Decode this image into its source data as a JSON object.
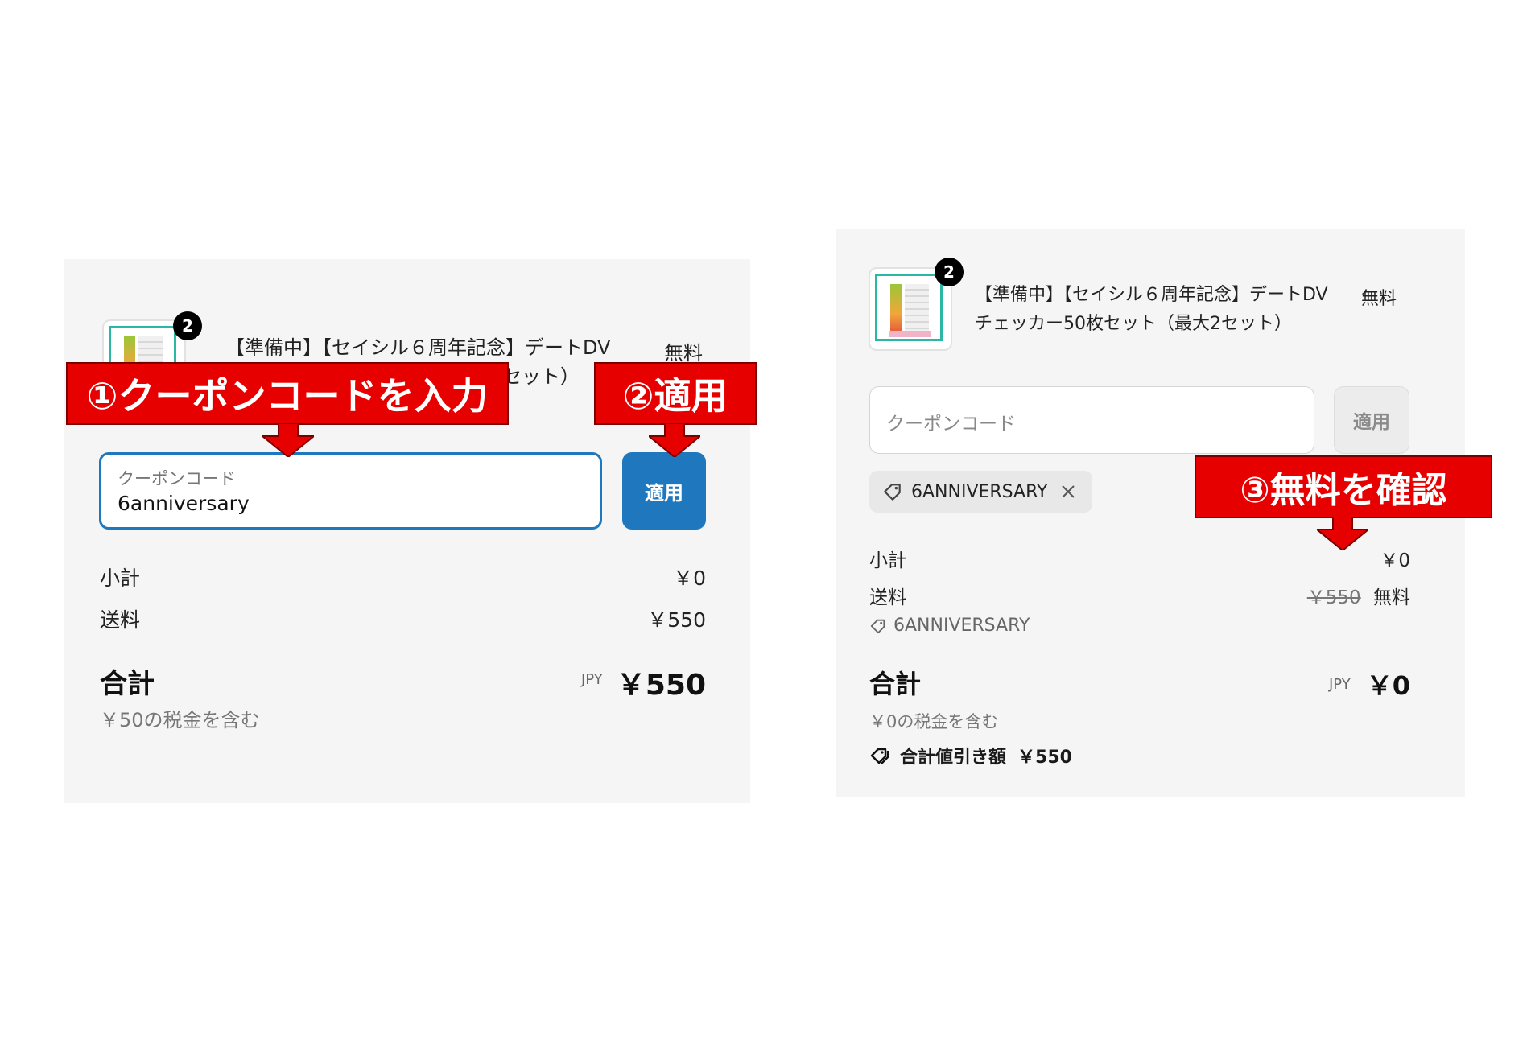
{
  "left": {
    "product": {
      "badge": "2",
      "title_line1": "【準備中】【セイシル６周年記念】デートDV",
      "title_line2_visible": "セット）",
      "price": "無料"
    },
    "coupon_field": {
      "label": "クーポンコード",
      "value": "6anniversary"
    },
    "apply_button": "適用",
    "subtotal": {
      "label": "小計",
      "value": "￥0"
    },
    "shipping": {
      "label": "送料",
      "value": "￥550"
    },
    "total": {
      "label": "合計",
      "currency": "JPY",
      "value": "￥550"
    },
    "tax_note": "￥50の税金を含む"
  },
  "right": {
    "product": {
      "badge": "2",
      "title_line1": "【準備中】【セイシル６周年記念】デートDV",
      "title_line2": "チェッカー50枚セット（最大2セット）",
      "price": "無料"
    },
    "coupon_field": {
      "placeholder": "クーポンコード"
    },
    "apply_button": "適用",
    "applied_code": "6ANNIVERSARY",
    "subtotal": {
      "label": "小計",
      "value": "￥0"
    },
    "shipping": {
      "label": "送料",
      "original": "￥550",
      "value": "無料"
    },
    "discount_code": "6ANNIVERSARY",
    "total": {
      "label": "合計",
      "currency": "JPY",
      "value": "￥0"
    },
    "tax_note": "￥0の税金を含む",
    "total_savings": {
      "label": "合計値引き額",
      "value": "￥550"
    }
  },
  "callouts": {
    "step1": "①クーポンコードを入力",
    "step2": "②適用",
    "step3": "③無料を確認"
  },
  "colors": {
    "accent": "#1f77bd",
    "callout": "#e60000"
  }
}
